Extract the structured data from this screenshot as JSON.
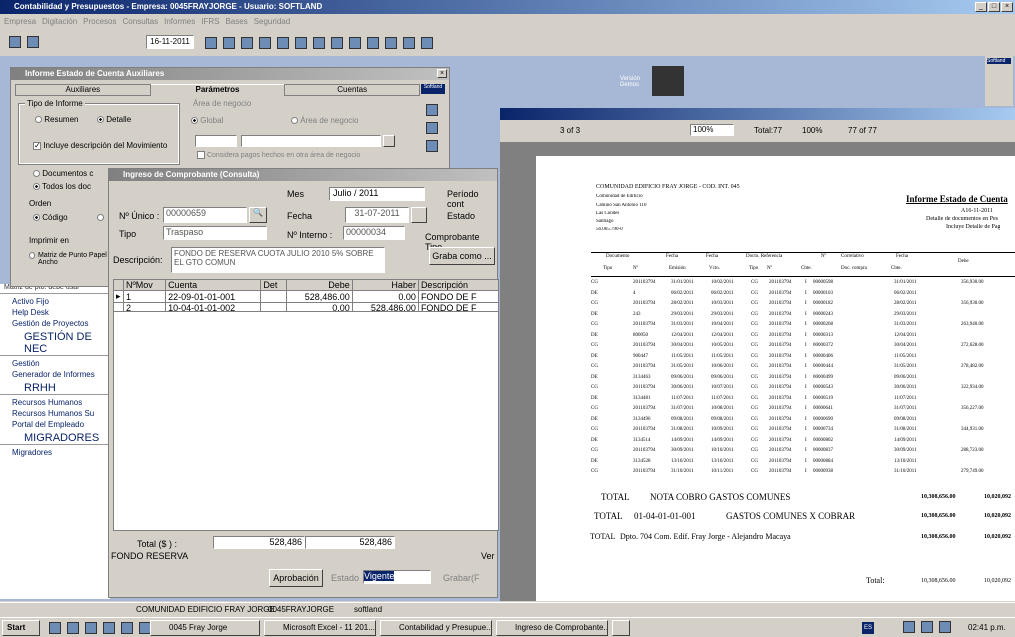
{
  "app": {
    "title": "Contabilidad y Presupuestos - Empresa: 0045FRAYJORGE - Usuario: SOFTLAND",
    "menu": [
      "Empresa",
      "Digitación",
      "Procesos",
      "Consultas",
      "Informes",
      "IFRS",
      "Bases",
      "Seguridad"
    ],
    "date": "16-11-2011"
  },
  "informe": {
    "title": "Informe Estado de Cuenta Auxiliares",
    "tabs": [
      "Auxiliares",
      "Parámetros",
      "Cuentas"
    ],
    "brand": "Softland",
    "tipo_label": "Tipo de Informe",
    "resumen": "Resumen",
    "detalle": "Detalle",
    "incluye": "Incluye descripción del Movimiento",
    "area_label": "Área de negocio",
    "global": "Global",
    "area": "Área de negocio",
    "considera": "Considera pagos hechos en otra área de negocio",
    "docs1": "Documentos c",
    "docs2": "Todos los doc",
    "orden": "Orden",
    "codigo": "Código",
    "imprimir": "Imprimir en",
    "matriz": "Matriz de Punto Papel Ancho",
    "nota": "Matriz de pto. debe usar"
  },
  "side": {
    "items1": [
      "Activo Fijo",
      "Help Desk",
      "Gestión de Proyectos"
    ],
    "h1": "GESTIÓN DE NEC",
    "items2": [
      "Gestión",
      "Generador de Informes"
    ],
    "h2": "RRHH",
    "items3": [
      "Recursos Humanos",
      "Recursos Humanos Su",
      "Portal del Empleado"
    ],
    "h3": "MIGRADORES",
    "items4": [
      "Migradores"
    ]
  },
  "comp": {
    "title": "Ingreso de Comprobante (Consulta)",
    "mes_label": "Mes",
    "mes": "Julio / 2011",
    "periodo": "Período cont",
    "nunico_label": "Nº Único :",
    "nunico": "00000659",
    "fecha_label": "Fecha",
    "fecha": "31-07-2011",
    "estado": "Estado",
    "tipo_label": "Tipo",
    "tipo": "Traspaso",
    "ninterno_label": "Nº Interno :",
    "ninterno": "00000034",
    "comp_tipo": "Comprobante Tipo",
    "desc_label": "Descripción:",
    "desc": "FONDO DE RESERVA CUOTA JULIO 2010 5% SOBRE EL GTO COMUN",
    "graba": "Graba como ...",
    "cols": [
      "NºMov",
      "Cuenta",
      "Det",
      "Debe",
      "Haber",
      "Descripción"
    ],
    "rows": [
      [
        "1",
        "22-09-01-01-001",
        "",
        "528,486.00",
        "0.00",
        "FONDO DE F"
      ],
      [
        "2",
        "10-04-01-01-002",
        "",
        "0.00",
        "528,486.00",
        "FONDO DE F"
      ]
    ],
    "total_label": "Total ($ ) :",
    "total_debe": "528,486",
    "total_haber": "528,486",
    "footer": "FONDO RESERVA",
    "ver": "Ver",
    "aprobacion": "Aprobación",
    "estado_label": "Estado",
    "estado_val": "Vigente",
    "grabar": "Grabar(F"
  },
  "viewer": {
    "page": "3 of 3",
    "zoom": "100%",
    "total": "Total:77",
    "pct": "100%",
    "of": "77 of 77",
    "demo": "Versión Demos",
    "brand2": "Softland"
  },
  "report": {
    "h1": "COMUNIDAD EDIFICIO FRAY JORGE - COD. INT. 045",
    "h2": "Comunidad de Edificio",
    "h3": "Camino San Antonio 110",
    "h4": "Las Condes",
    "h5": "Santiago",
    "h6": "56.065.790-0",
    "title": "Informe Estado de Cuenta",
    "date": "A16-11-2011",
    "sub1": "Detalle de documentos en Pes",
    "sub2": "Incluye Detalle de Pag",
    "colsA": [
      "Documento",
      "Fecha",
      "Fecha",
      "Docto. Referencia",
      "Nº",
      "Correlativo",
      "Fecha",
      "Debe"
    ],
    "colsB": [
      "Tipo",
      "Nº",
      "Emisión",
      "Vcto.",
      "Tipo",
      "Nº",
      "Cbte.",
      "Doc. compra",
      "Cbte."
    ],
    "rows": [
      [
        "CG",
        "201103794",
        "31/01/2011",
        "10/02/2011",
        "CG",
        "201103794",
        "I",
        "00000598",
        "31/01/2011",
        "356,930.00",
        ""
      ],
      [
        "DE",
        "4",
        "06/02/2011",
        "06/02/2011",
        "CG",
        "201103794",
        "I",
        "00000103",
        "06/02/2011",
        "",
        "DE"
      ],
      [
        "CG",
        "201103794",
        "28/02/2011",
        "10/03/2011",
        "CG",
        "201103794",
        "I",
        "00000182",
        "28/02/2011",
        "356,930.00",
        ""
      ],
      [
        "DE",
        "243",
        "29/03/2011",
        "29/03/2011",
        "CG",
        "201103794",
        "I",
        "00000243",
        "29/03/2011",
        "",
        "DE"
      ],
      [
        "CG",
        "201103794",
        "31/03/2011",
        "10/04/2011",
        "CG",
        "201103794",
        "I",
        "00000268",
        "31/03/2011",
        "263,940.00",
        ""
      ],
      [
        "DE",
        "800050",
        "12/04/2011",
        "12/04/2011",
        "CG",
        "201103794",
        "I",
        "00000313",
        "12/04/2011",
        "",
        "DE"
      ],
      [
        "CG",
        "201103794",
        "30/04/2011",
        "10/05/2011",
        "CG",
        "201103794",
        "I",
        "00000372",
        "30/04/2011",
        "272,628.00",
        ""
      ],
      [
        "DE",
        "900447",
        "11/05/2011",
        "11/05/2011",
        "CG",
        "201103794",
        "I",
        "00000406",
        "11/05/2011",
        "",
        "DE"
      ],
      [
        "CG",
        "201103794",
        "31/05/2011",
        "10/06/2011",
        "CG",
        "201103794",
        "I",
        "00000444",
        "31/05/2011",
        "278,482.00",
        ""
      ],
      [
        "DE",
        "3134463",
        "09/06/2011",
        "09/06/2011",
        "CG",
        "201103794",
        "I",
        "00000499",
        "09/06/2011",
        "",
        "DE"
      ],
      [
        "CG",
        "201103794",
        "30/06/2011",
        "10/07/2011",
        "CG",
        "201103794",
        "I",
        "00000543",
        "30/06/2011",
        "322,934.00",
        ""
      ],
      [
        "DE",
        "3134481",
        "11/07/2011",
        "11/07/2011",
        "CG",
        "201103794",
        "I",
        "00000519",
        "11/07/2011",
        "",
        "DE"
      ],
      [
        "CG",
        "201103794",
        "31/07/2011",
        "10/08/2011",
        "CG",
        "201103794",
        "I",
        "00000641",
        "31/07/2011",
        "356,227.00",
        ""
      ],
      [
        "DE",
        "3134496",
        "09/08/2011",
        "09/08/2011",
        "CG",
        "201103794",
        "I",
        "00000690",
        "09/08/2011",
        "",
        "DE"
      ],
      [
        "CG",
        "201103794",
        "31/08/2011",
        "10/09/2011",
        "CG",
        "201103794",
        "I",
        "00000734",
        "31/08/2011",
        "344,931.00",
        ""
      ],
      [
        "DE",
        "3134514",
        "14/09/2011",
        "14/09/2011",
        "CG",
        "201103794",
        "I",
        "00000802",
        "14/09/2011",
        "",
        "DE"
      ],
      [
        "CG",
        "201103794",
        "30/09/2011",
        "10/10/2011",
        "CG",
        "201103794",
        "I",
        "00000837",
        "30/09/2011",
        "288,723.00",
        ""
      ],
      [
        "DE",
        "3134528",
        "13/10/2011",
        "13/10/2011",
        "CG",
        "201103794",
        "I",
        "00000884",
        "13/10/2011",
        "",
        "DE"
      ],
      [
        "CG",
        "201103794",
        "31/10/2011",
        "10/11/2011",
        "CG",
        "201103794",
        "I",
        "00000938",
        "31/10/2011",
        "279,749.00",
        ""
      ]
    ],
    "tot1_label": "TOTAL",
    "tot1_desc": "NOTA COBRO GASTOS COMUNES",
    "tot1_a": "10,308,656.00",
    "tot1_b": "10,020,092",
    "tot2_label": "TOTAL",
    "tot2_code": "01-04-01-01-001",
    "tot2_desc": "GASTOS COMUNES X COBRAR",
    "tot2_a": "10,308,656.00",
    "tot2_b": "10,020,092",
    "tot3_label": "TOTAL",
    "tot3_desc": "Dpto. 704 Com. Edif. Fray Jorge - Alejandro Macaya",
    "tot3_a": "10,308,656.00",
    "tot3_b": "10,020,092",
    "grand_label": "Total:",
    "grand_a": "10,308,656.00",
    "grand_b": "10,020,092"
  },
  "status": {
    "s1": "COMUNIDAD EDIFICIO FRAY JORGE",
    "s2": "0045FRAYJORGE",
    "s3": "softland"
  },
  "taskbar": {
    "start": "Start",
    "tasks": [
      "0045 Fray Jorge",
      "Microsoft Excel - 11 201...",
      "Contabilidad y Presupue...",
      "Ingreso de Comprobante..."
    ],
    "es": "ES",
    "time": "02:41 p.m."
  }
}
